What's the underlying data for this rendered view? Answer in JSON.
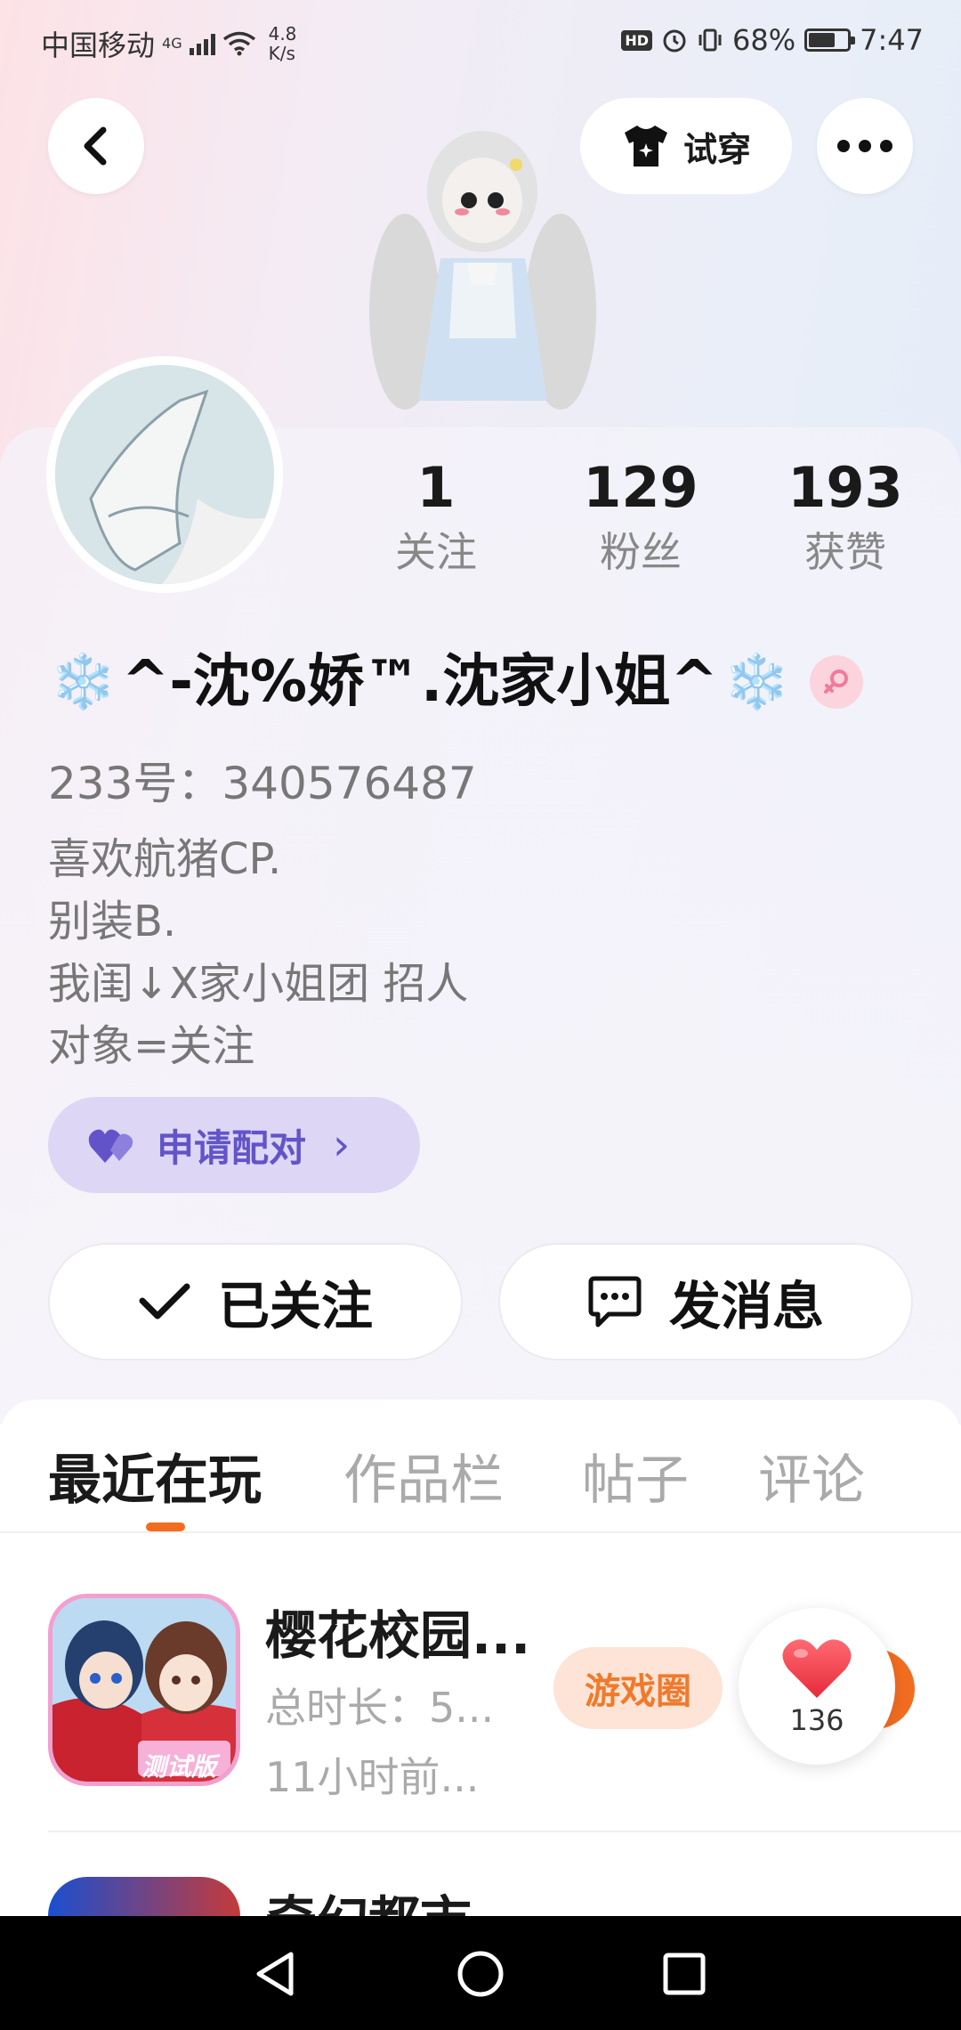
{
  "status_bar": {
    "carrier": "中国移动",
    "network": "4G",
    "net_speed_value": "4.8",
    "net_speed_unit": "K/s",
    "hd": "HD",
    "battery": "68%",
    "battery_level": 0.68,
    "time": "7:47"
  },
  "header": {
    "try_on_label": "试穿"
  },
  "stats": [
    {
      "value": "1",
      "label": "关注"
    },
    {
      "value": "129",
      "label": "粉丝"
    },
    {
      "value": "193",
      "label": "获赞"
    }
  ],
  "profile": {
    "snowflake": "❄️",
    "name": "^-沈%娇™.沈家小姐^",
    "uid": "233号：340576487",
    "bio": [
      "喜欢航猪CP.",
      "别装B.",
      "我闺↓X家小姐团 招人",
      "对象=关注"
    ]
  },
  "pair_button": {
    "label": "申请配对",
    "chevron": "›"
  },
  "actions": {
    "follow_label": "已关注",
    "message_label": "发消息"
  },
  "tabs": [
    {
      "label": "最近在玩",
      "active": true
    },
    {
      "label": "作品栏",
      "active": false
    },
    {
      "label": "帖子",
      "active": false
    },
    {
      "label": "评论",
      "active": false
    }
  ],
  "games": [
    {
      "title": "樱花校园...",
      "meta_duration": "总时长：5...",
      "meta_time": "11小时前...",
      "badge_text": "测试版",
      "circle_label": "游戏圈",
      "like_count": "136"
    },
    {
      "title": "奇幻都市"
    }
  ],
  "colors": {
    "accent": "#f36d21",
    "pair_text": "#6254c8",
    "pair_bg": "#ddd6f5",
    "heart": "#f0434e"
  }
}
